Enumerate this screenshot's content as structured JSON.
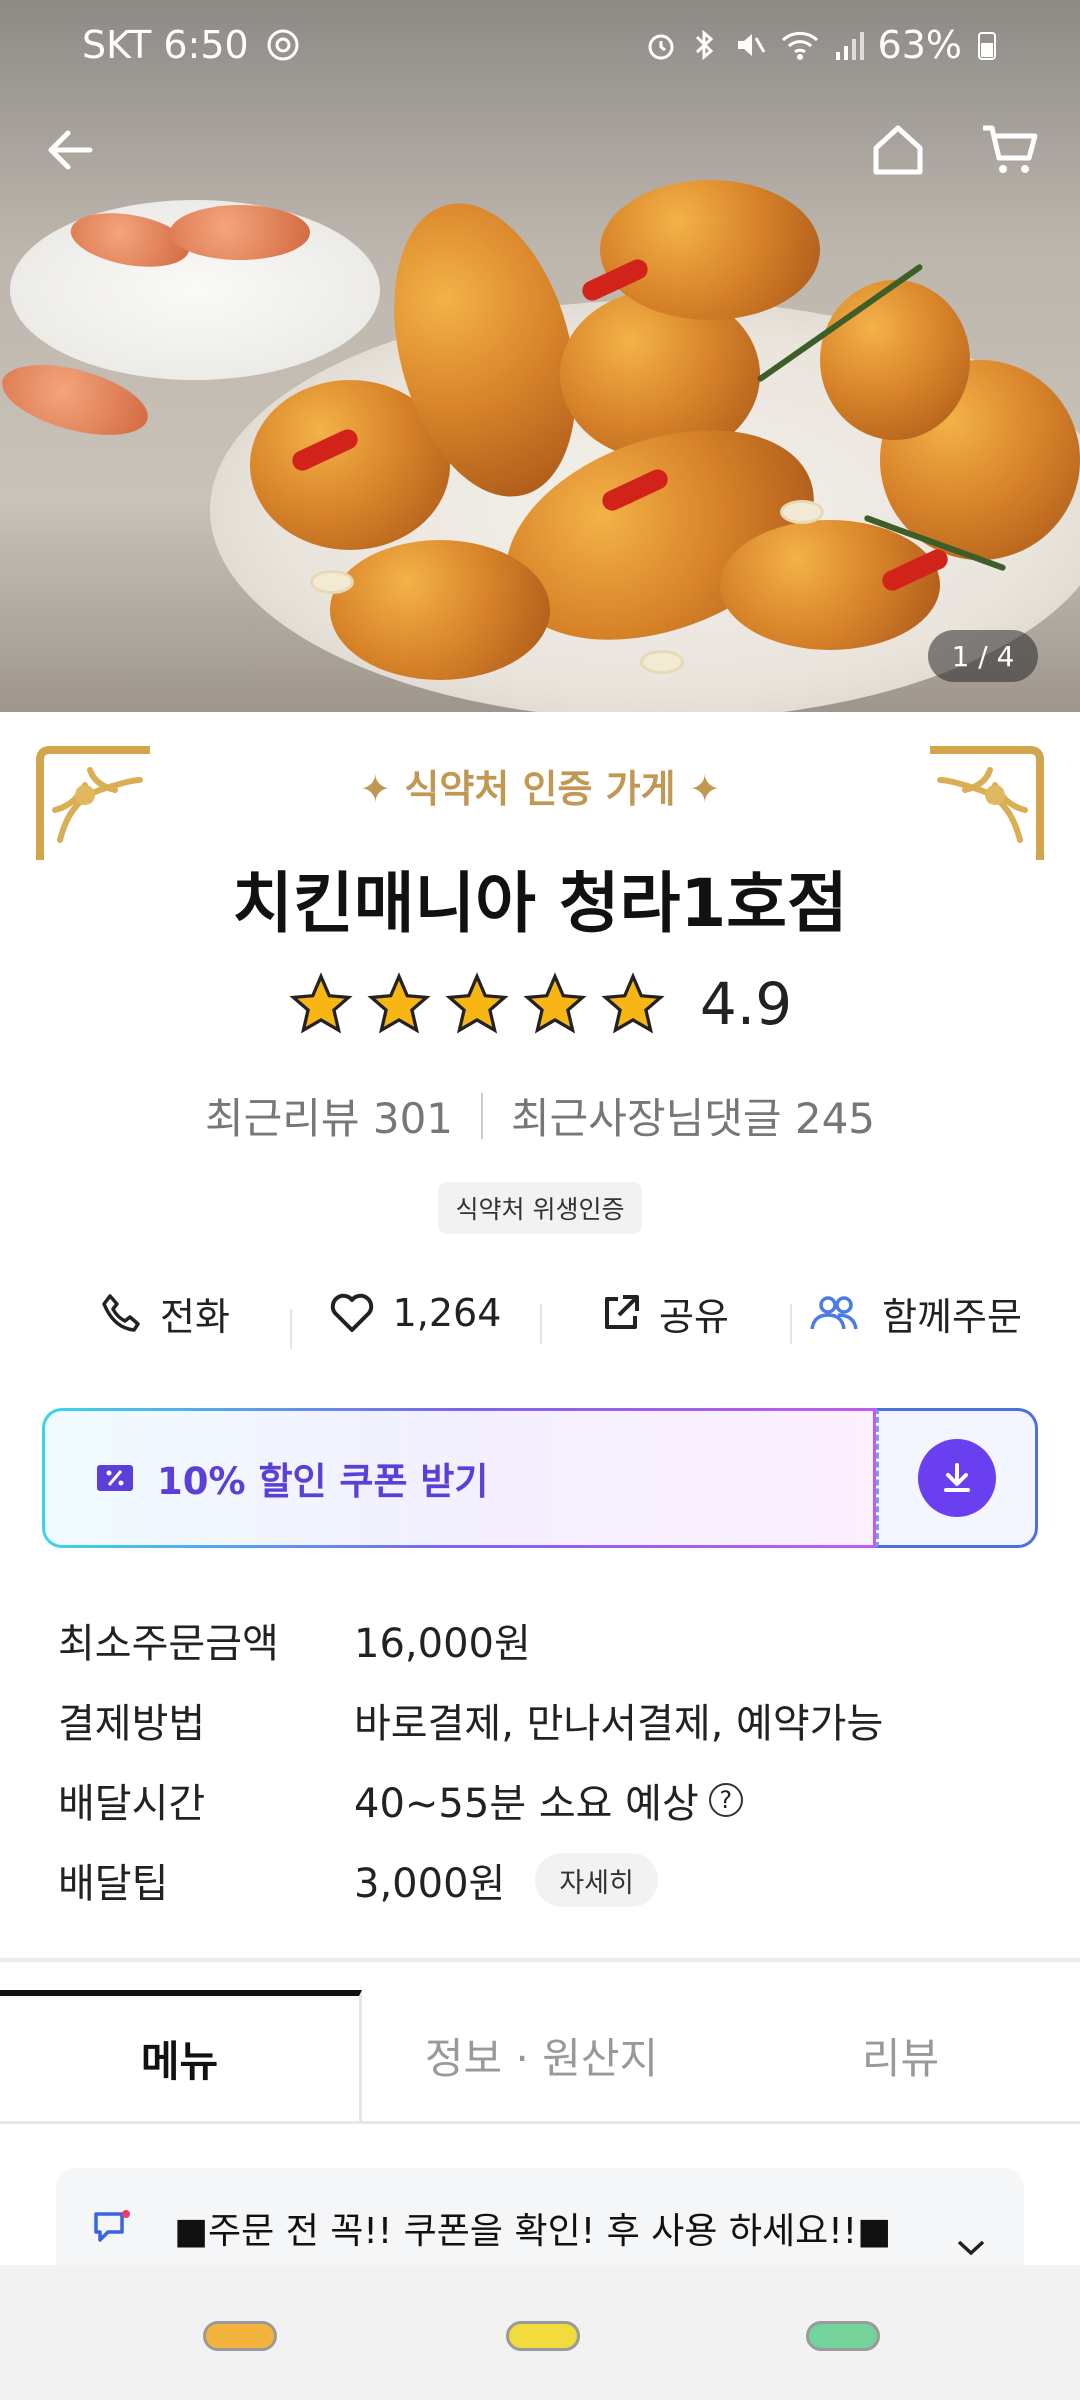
{
  "status_bar": {
    "carrier_time": "SKT 6:50",
    "battery": "63%"
  },
  "hero": {
    "page_counter": "1 / 4"
  },
  "store": {
    "certification": "식약처 인증 가게",
    "name": "치킨매니아 청라1호점",
    "rating": "4.9",
    "stars": 5,
    "recent_reviews": "최근리뷰 301",
    "recent_owner_replies": "최근사장님댓글 245",
    "hygiene_tag": "식약처 위생인증"
  },
  "actions": {
    "call": "전화",
    "likes": "1,264",
    "share": "공유",
    "group_order": "함께주문"
  },
  "coupon": {
    "label": "10% 할인 쿠폰 받기"
  },
  "info": {
    "min_order_label": "최소주문금액",
    "min_order_value": "16,000원",
    "payment_label": "결제방법",
    "payment_value": "바로결제, 만나서결제, 예약가능",
    "delivery_time_label": "배달시간",
    "delivery_time_value": "40~55분 소요 예상",
    "delivery_tip_label": "배달팁",
    "delivery_tip_value": "3,000원",
    "detail_button": "자세히"
  },
  "tabs": [
    "메뉴",
    "정보 · 원산지",
    "리뷰"
  ],
  "notice": {
    "text": "■주문 전 꼭!! 쿠폰을 확인! 후 사용 하세요!!■"
  },
  "colors": {
    "accent": "#6a3ff0",
    "gold": "#c29752",
    "coupon_text": "#5b3fd8"
  }
}
